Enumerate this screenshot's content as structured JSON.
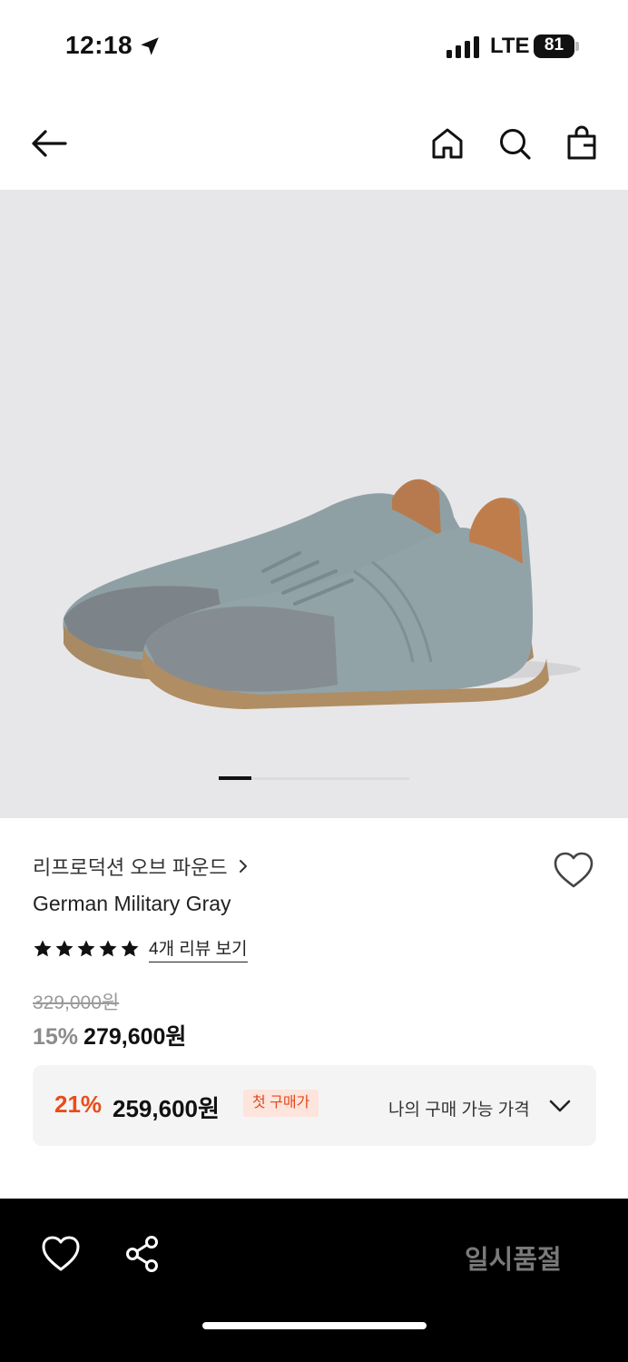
{
  "status_bar": {
    "time": "12:18",
    "network": "LTE",
    "battery": "81",
    "battery_fraction": 0.81
  },
  "nav": {
    "back_icon": "arrow-left-icon",
    "home_icon": "home-icon",
    "search_icon": "search-icon",
    "bag_icon": "shopping-bag-icon"
  },
  "gallery": {
    "image_subject": "product-photo",
    "pager_fraction": 0.17
  },
  "product": {
    "brand": "리프로덕션 오브 파운드",
    "name": "German Military Gray",
    "rating_stars": 5,
    "review_link": "4개 리뷰 보기",
    "original_price": "329,000원",
    "discount_rate": "15%",
    "sale_price": "279,600원"
  },
  "benefit": {
    "discount_rate": "21%",
    "price": "259,600원",
    "badge": "첫 구매가",
    "label": "나의 구매 가능 가격",
    "accent_color": "#ea4c1a"
  },
  "bottom_bar": {
    "wish_icon": "heart-icon",
    "share_icon": "share-icon",
    "status": "일시품절"
  }
}
